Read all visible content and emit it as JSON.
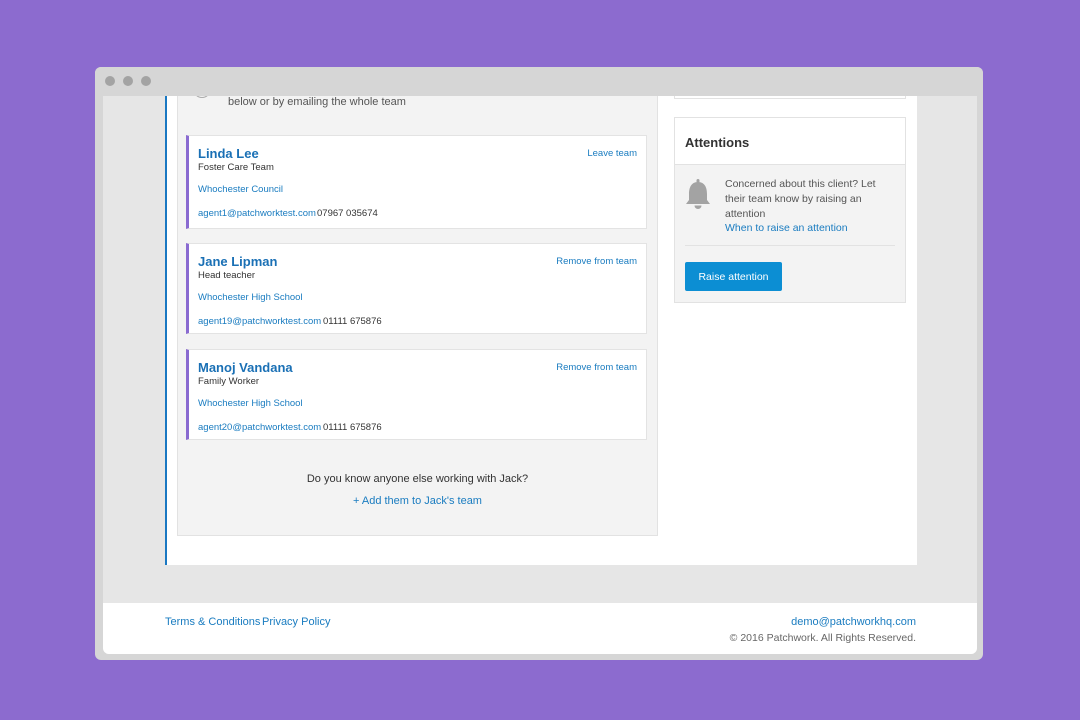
{
  "intro": {
    "text": "below or by emailing the whole team"
  },
  "team": [
    {
      "name": "Linda Lee",
      "role": "Foster Care Team",
      "org": "Whochester Council",
      "email": "agent1@patchworktest.com",
      "phone": "07967 035674",
      "action": "Leave team"
    },
    {
      "name": "Jane Lipman",
      "role": "Head teacher",
      "org": "Whochester High School",
      "email": "agent19@patchworktest.com",
      "phone": "01111 675876",
      "action": "Remove from team"
    },
    {
      "name": "Manoj Vandana",
      "role": "Family Worker",
      "org": "Whochester High School",
      "email": "agent20@patchworktest.com",
      "phone": "01111 675876",
      "action": "Remove from team"
    }
  ],
  "prompt": {
    "question": "Do you know anyone else working with Jack?",
    "add_link": "+ Add them to Jack's team"
  },
  "attentions": {
    "title": "Attentions",
    "text": "Concerned about this client? Let their team know by raising an attention",
    "link": "When to raise an attention",
    "button": "Raise attention",
    "icon": "bell-icon"
  },
  "footer": {
    "terms": "Terms & Conditions",
    "privacy": "Privacy Policy",
    "email": "demo@patchworkhq.com",
    "copyright": "© 2016 Patchwork. All Rights Reserved."
  },
  "colors": {
    "background": "#8c6bcf",
    "accent": "#1a7cc0",
    "card_border": "#8a6bd1",
    "button": "#0c8ed3"
  }
}
